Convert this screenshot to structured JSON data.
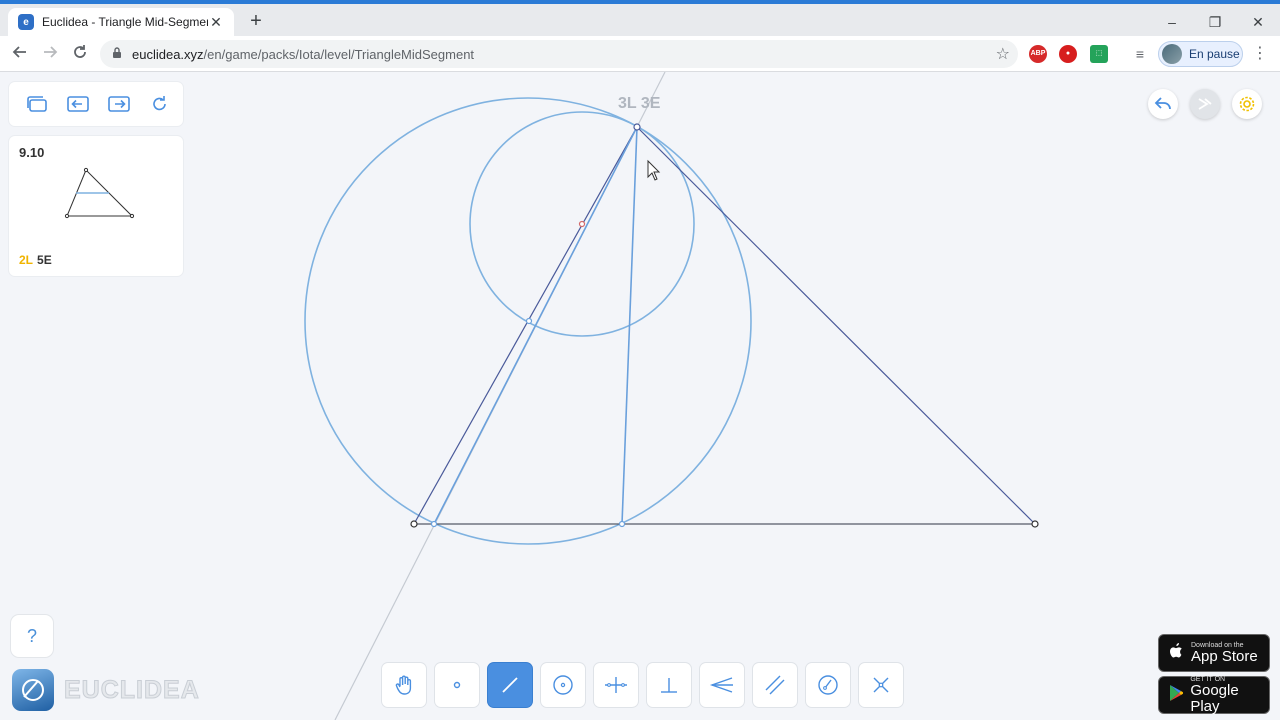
{
  "browser": {
    "tab_title": "Euclidea - Triangle Mid-Segment",
    "tab_favicon": "e",
    "new_tab_glyph": "+",
    "close_glyph": "✕",
    "url_host": "euclidea.xyz",
    "url_path": "/en/game/packs/Iota/level/TriangleMidSegment",
    "extensions": [
      "ABP",
      "stop-icon",
      "extension-icon"
    ],
    "profile_label": "En pause",
    "window_controls": [
      "–",
      "❐",
      "✕"
    ]
  },
  "level_card": {
    "number": "9.10",
    "score_lines": "2L",
    "score_elements": "5E"
  },
  "goal_counter": "3L 3E",
  "help_label": "?",
  "wordmark": "EUCLIDEA",
  "tools": [
    {
      "name": "move-tool",
      "active": false
    },
    {
      "name": "point-tool",
      "active": false
    },
    {
      "name": "line-tool",
      "active": true
    },
    {
      "name": "circle-tool",
      "active": false
    },
    {
      "name": "perpendicular-bisector-tool",
      "active": false
    },
    {
      "name": "perpendicular-tool",
      "active": false
    },
    {
      "name": "angle-bisector-tool",
      "active": false
    },
    {
      "name": "parallel-tool",
      "active": false
    },
    {
      "name": "compass-tool",
      "active": false
    },
    {
      "name": "intersect-tool",
      "active": false
    }
  ],
  "store_badges": {
    "appstore_small": "Download on the",
    "appstore_big": "App Store",
    "googleplay_small": "GET IT ON",
    "googleplay_big": "Google Play"
  },
  "colors": {
    "accent": "#4a8fe0",
    "construction": "#7fb2e0",
    "triangle": "#4a5a9a",
    "score_gold": "#f0b400"
  }
}
